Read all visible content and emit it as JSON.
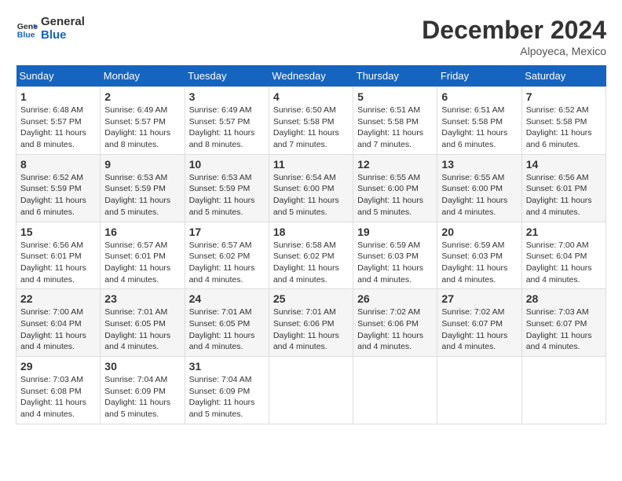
{
  "logo": {
    "text_general": "General",
    "text_blue": "Blue"
  },
  "title": "December 2024",
  "location": "Alpoyeca, Mexico",
  "days_of_week": [
    "Sunday",
    "Monday",
    "Tuesday",
    "Wednesday",
    "Thursday",
    "Friday",
    "Saturday"
  ],
  "weeks": [
    [
      {
        "day": "1",
        "sunrise": "6:48 AM",
        "sunset": "5:57 PM",
        "daylight": "11 hours and 8 minutes."
      },
      {
        "day": "2",
        "sunrise": "6:49 AM",
        "sunset": "5:57 PM",
        "daylight": "11 hours and 8 minutes."
      },
      {
        "day": "3",
        "sunrise": "6:49 AM",
        "sunset": "5:57 PM",
        "daylight": "11 hours and 8 minutes."
      },
      {
        "day": "4",
        "sunrise": "6:50 AM",
        "sunset": "5:58 PM",
        "daylight": "11 hours and 7 minutes."
      },
      {
        "day": "5",
        "sunrise": "6:51 AM",
        "sunset": "5:58 PM",
        "daylight": "11 hours and 7 minutes."
      },
      {
        "day": "6",
        "sunrise": "6:51 AM",
        "sunset": "5:58 PM",
        "daylight": "11 hours and 6 minutes."
      },
      {
        "day": "7",
        "sunrise": "6:52 AM",
        "sunset": "5:58 PM",
        "daylight": "11 hours and 6 minutes."
      }
    ],
    [
      {
        "day": "8",
        "sunrise": "6:52 AM",
        "sunset": "5:59 PM",
        "daylight": "11 hours and 6 minutes."
      },
      {
        "day": "9",
        "sunrise": "6:53 AM",
        "sunset": "5:59 PM",
        "daylight": "11 hours and 5 minutes."
      },
      {
        "day": "10",
        "sunrise": "6:53 AM",
        "sunset": "5:59 PM",
        "daylight": "11 hours and 5 minutes."
      },
      {
        "day": "11",
        "sunrise": "6:54 AM",
        "sunset": "6:00 PM",
        "daylight": "11 hours and 5 minutes."
      },
      {
        "day": "12",
        "sunrise": "6:55 AM",
        "sunset": "6:00 PM",
        "daylight": "11 hours and 5 minutes."
      },
      {
        "day": "13",
        "sunrise": "6:55 AM",
        "sunset": "6:00 PM",
        "daylight": "11 hours and 4 minutes."
      },
      {
        "day": "14",
        "sunrise": "6:56 AM",
        "sunset": "6:01 PM",
        "daylight": "11 hours and 4 minutes."
      }
    ],
    [
      {
        "day": "15",
        "sunrise": "6:56 AM",
        "sunset": "6:01 PM",
        "daylight": "11 hours and 4 minutes."
      },
      {
        "day": "16",
        "sunrise": "6:57 AM",
        "sunset": "6:01 PM",
        "daylight": "11 hours and 4 minutes."
      },
      {
        "day": "17",
        "sunrise": "6:57 AM",
        "sunset": "6:02 PM",
        "daylight": "11 hours and 4 minutes."
      },
      {
        "day": "18",
        "sunrise": "6:58 AM",
        "sunset": "6:02 PM",
        "daylight": "11 hours and 4 minutes."
      },
      {
        "day": "19",
        "sunrise": "6:59 AM",
        "sunset": "6:03 PM",
        "daylight": "11 hours and 4 minutes."
      },
      {
        "day": "20",
        "sunrise": "6:59 AM",
        "sunset": "6:03 PM",
        "daylight": "11 hours and 4 minutes."
      },
      {
        "day": "21",
        "sunrise": "7:00 AM",
        "sunset": "6:04 PM",
        "daylight": "11 hours and 4 minutes."
      }
    ],
    [
      {
        "day": "22",
        "sunrise": "7:00 AM",
        "sunset": "6:04 PM",
        "daylight": "11 hours and 4 minutes."
      },
      {
        "day": "23",
        "sunrise": "7:01 AM",
        "sunset": "6:05 PM",
        "daylight": "11 hours and 4 minutes."
      },
      {
        "day": "24",
        "sunrise": "7:01 AM",
        "sunset": "6:05 PM",
        "daylight": "11 hours and 4 minutes."
      },
      {
        "day": "25",
        "sunrise": "7:01 AM",
        "sunset": "6:06 PM",
        "daylight": "11 hours and 4 minutes."
      },
      {
        "day": "26",
        "sunrise": "7:02 AM",
        "sunset": "6:06 PM",
        "daylight": "11 hours and 4 minutes."
      },
      {
        "day": "27",
        "sunrise": "7:02 AM",
        "sunset": "6:07 PM",
        "daylight": "11 hours and 4 minutes."
      },
      {
        "day": "28",
        "sunrise": "7:03 AM",
        "sunset": "6:07 PM",
        "daylight": "11 hours and 4 minutes."
      }
    ],
    [
      {
        "day": "29",
        "sunrise": "7:03 AM",
        "sunset": "6:08 PM",
        "daylight": "11 hours and 4 minutes."
      },
      {
        "day": "30",
        "sunrise": "7:04 AM",
        "sunset": "6:09 PM",
        "daylight": "11 hours and 5 minutes."
      },
      {
        "day": "31",
        "sunrise": "7:04 AM",
        "sunset": "6:09 PM",
        "daylight": "11 hours and 5 minutes."
      },
      null,
      null,
      null,
      null
    ]
  ],
  "labels": {
    "sunrise": "Sunrise:",
    "sunset": "Sunset:",
    "daylight": "Daylight:"
  }
}
